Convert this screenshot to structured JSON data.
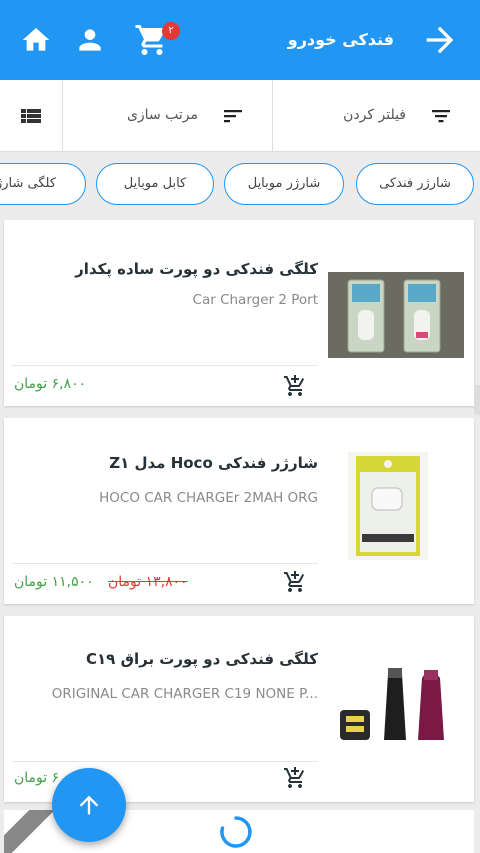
{
  "appbar": {
    "title": "فندکی خودرو",
    "cart_count": "۲",
    "icons": [
      "arrow-forward-icon",
      "cart-icon",
      "account-icon",
      "home-icon"
    ],
    "color": "#2196f3"
  },
  "toolbar": {
    "filter_label": "فیلتر کردن",
    "sort_label": "مرتب سازی"
  },
  "chips": [
    {
      "label": "شارژر فندکی"
    },
    {
      "label": "شارژر موبایل"
    },
    {
      "label": "کابل موبایل"
    },
    {
      "label": "کلگی شارژ"
    }
  ],
  "products": [
    {
      "name": "کلگی فندکی دو پورت ساده پکدار",
      "subtitle": "Car Charger 2 Port",
      "price": "۶,۸۰۰ تومان",
      "old_price": ""
    },
    {
      "name": "شارژر فندکی Hoco مدل Z۱",
      "subtitle": "HOCO CAR CHARGEr 2MAH ORG",
      "price": "۱۱,۵۰۰ تومان",
      "old_price": "۱۳,۸۰۰ تومان"
    },
    {
      "name": "کلگی فندکی دو پورت براق C۱۹",
      "subtitle": "ORIGINAL CAR CHARGER C19 NONE P...",
      "price": "۶ تومان",
      "old_price": ""
    }
  ],
  "colors": {
    "accent": "#2196f3",
    "price": "#43a047",
    "old_price": "#e53935"
  }
}
